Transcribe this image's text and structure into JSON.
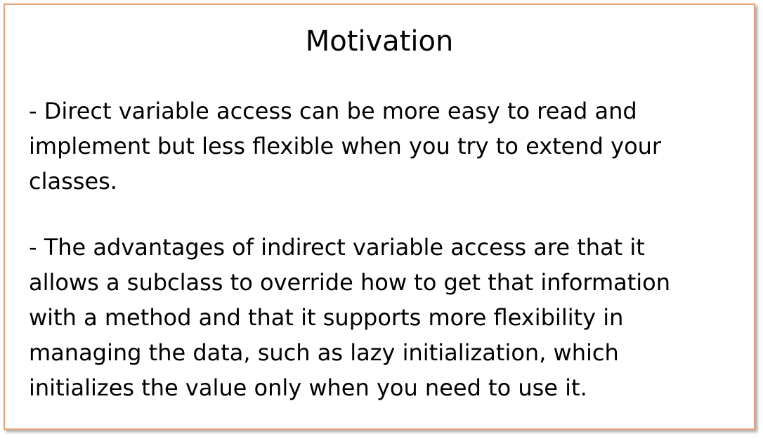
{
  "slide": {
    "title": "Motivation",
    "bullets": [
      {
        "lines": [
          "- Direct variable access can be more easy to read and",
          "implement but less flexible when you try to extend your",
          "classes."
        ]
      },
      {
        "lines": [
          "- The advantages of indirect variable access are that it",
          "allows a subclass to override how to get that information",
          "with a method and that it supports more flexibility in",
          "managing the data, such as lazy initialization, which",
          "initializes the value only when you need to use it."
        ]
      }
    ],
    "border_color": "#e5a27a"
  }
}
